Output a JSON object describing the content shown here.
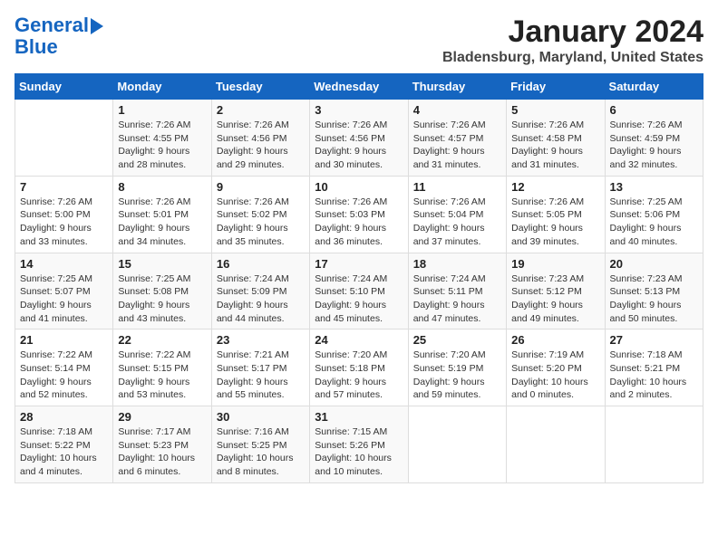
{
  "header": {
    "logo_line1": "General",
    "logo_line2": "Blue",
    "month": "January 2024",
    "location": "Bladensburg, Maryland, United States"
  },
  "days_of_week": [
    "Sunday",
    "Monday",
    "Tuesday",
    "Wednesday",
    "Thursday",
    "Friday",
    "Saturday"
  ],
  "weeks": [
    [
      {
        "day": "",
        "info": ""
      },
      {
        "day": "1",
        "info": "Sunrise: 7:26 AM\nSunset: 4:55 PM\nDaylight: 9 hours\nand 28 minutes."
      },
      {
        "day": "2",
        "info": "Sunrise: 7:26 AM\nSunset: 4:56 PM\nDaylight: 9 hours\nand 29 minutes."
      },
      {
        "day": "3",
        "info": "Sunrise: 7:26 AM\nSunset: 4:56 PM\nDaylight: 9 hours\nand 30 minutes."
      },
      {
        "day": "4",
        "info": "Sunrise: 7:26 AM\nSunset: 4:57 PM\nDaylight: 9 hours\nand 31 minutes."
      },
      {
        "day": "5",
        "info": "Sunrise: 7:26 AM\nSunset: 4:58 PM\nDaylight: 9 hours\nand 31 minutes."
      },
      {
        "day": "6",
        "info": "Sunrise: 7:26 AM\nSunset: 4:59 PM\nDaylight: 9 hours\nand 32 minutes."
      }
    ],
    [
      {
        "day": "7",
        "info": "Sunrise: 7:26 AM\nSunset: 5:00 PM\nDaylight: 9 hours\nand 33 minutes."
      },
      {
        "day": "8",
        "info": "Sunrise: 7:26 AM\nSunset: 5:01 PM\nDaylight: 9 hours\nand 34 minutes."
      },
      {
        "day": "9",
        "info": "Sunrise: 7:26 AM\nSunset: 5:02 PM\nDaylight: 9 hours\nand 35 minutes."
      },
      {
        "day": "10",
        "info": "Sunrise: 7:26 AM\nSunset: 5:03 PM\nDaylight: 9 hours\nand 36 minutes."
      },
      {
        "day": "11",
        "info": "Sunrise: 7:26 AM\nSunset: 5:04 PM\nDaylight: 9 hours\nand 37 minutes."
      },
      {
        "day": "12",
        "info": "Sunrise: 7:26 AM\nSunset: 5:05 PM\nDaylight: 9 hours\nand 39 minutes."
      },
      {
        "day": "13",
        "info": "Sunrise: 7:25 AM\nSunset: 5:06 PM\nDaylight: 9 hours\nand 40 minutes."
      }
    ],
    [
      {
        "day": "14",
        "info": "Sunrise: 7:25 AM\nSunset: 5:07 PM\nDaylight: 9 hours\nand 41 minutes."
      },
      {
        "day": "15",
        "info": "Sunrise: 7:25 AM\nSunset: 5:08 PM\nDaylight: 9 hours\nand 43 minutes."
      },
      {
        "day": "16",
        "info": "Sunrise: 7:24 AM\nSunset: 5:09 PM\nDaylight: 9 hours\nand 44 minutes."
      },
      {
        "day": "17",
        "info": "Sunrise: 7:24 AM\nSunset: 5:10 PM\nDaylight: 9 hours\nand 45 minutes."
      },
      {
        "day": "18",
        "info": "Sunrise: 7:24 AM\nSunset: 5:11 PM\nDaylight: 9 hours\nand 47 minutes."
      },
      {
        "day": "19",
        "info": "Sunrise: 7:23 AM\nSunset: 5:12 PM\nDaylight: 9 hours\nand 49 minutes."
      },
      {
        "day": "20",
        "info": "Sunrise: 7:23 AM\nSunset: 5:13 PM\nDaylight: 9 hours\nand 50 minutes."
      }
    ],
    [
      {
        "day": "21",
        "info": "Sunrise: 7:22 AM\nSunset: 5:14 PM\nDaylight: 9 hours\nand 52 minutes."
      },
      {
        "day": "22",
        "info": "Sunrise: 7:22 AM\nSunset: 5:15 PM\nDaylight: 9 hours\nand 53 minutes."
      },
      {
        "day": "23",
        "info": "Sunrise: 7:21 AM\nSunset: 5:17 PM\nDaylight: 9 hours\nand 55 minutes."
      },
      {
        "day": "24",
        "info": "Sunrise: 7:20 AM\nSunset: 5:18 PM\nDaylight: 9 hours\nand 57 minutes."
      },
      {
        "day": "25",
        "info": "Sunrise: 7:20 AM\nSunset: 5:19 PM\nDaylight: 9 hours\nand 59 minutes."
      },
      {
        "day": "26",
        "info": "Sunrise: 7:19 AM\nSunset: 5:20 PM\nDaylight: 10 hours\nand 0 minutes."
      },
      {
        "day": "27",
        "info": "Sunrise: 7:18 AM\nSunset: 5:21 PM\nDaylight: 10 hours\nand 2 minutes."
      }
    ],
    [
      {
        "day": "28",
        "info": "Sunrise: 7:18 AM\nSunset: 5:22 PM\nDaylight: 10 hours\nand 4 minutes."
      },
      {
        "day": "29",
        "info": "Sunrise: 7:17 AM\nSunset: 5:23 PM\nDaylight: 10 hours\nand 6 minutes."
      },
      {
        "day": "30",
        "info": "Sunrise: 7:16 AM\nSunset: 5:25 PM\nDaylight: 10 hours\nand 8 minutes."
      },
      {
        "day": "31",
        "info": "Sunrise: 7:15 AM\nSunset: 5:26 PM\nDaylight: 10 hours\nand 10 minutes."
      },
      {
        "day": "",
        "info": ""
      },
      {
        "day": "",
        "info": ""
      },
      {
        "day": "",
        "info": ""
      }
    ]
  ]
}
